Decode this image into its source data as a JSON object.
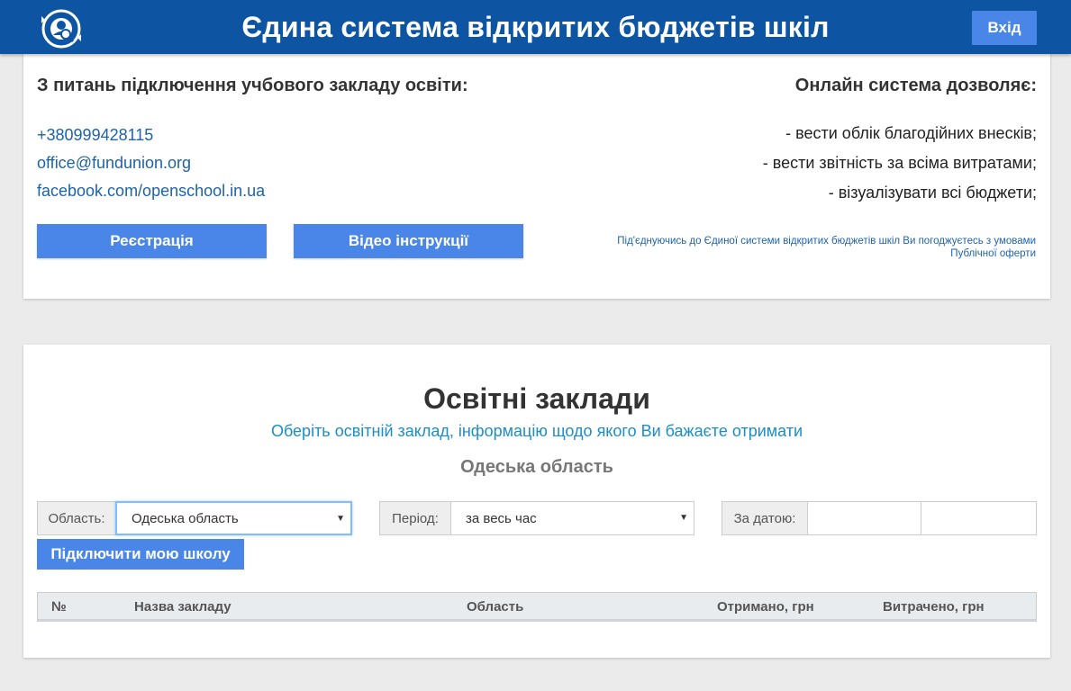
{
  "header": {
    "title": "Єдина система відкритих бюджетів шкіл",
    "login_label": "Вхід",
    "logo_icon": "magnifier-search-logo-icon",
    "background": "#0d55a3"
  },
  "info": {
    "left_title": "З питань підключення учбового закладу освіти:",
    "contacts": [
      "+380999428115",
      "office@fundunion.org",
      "facebook.com/openschool.in.ua"
    ],
    "right_title": "Онлайн система дозволяє:",
    "features": [
      "- вести облік благодійних внесків;",
      "- вести звітність за всіма витратами;",
      "- візуалізувати всі бюджети;"
    ],
    "register_label": "Реєстрація",
    "video_label": "Відео інструкції",
    "terms_line1": "Під'єднуючись до Єдиної системи відкритих бюджетів шкіл Ви погоджуєтесь з умовами",
    "terms_line2": "Публічної оферти"
  },
  "institutions": {
    "title": "Освітні заклади",
    "subtitle": "Оберіть освітній заклад, інформацію щодо якого Ви бажаєте отримати",
    "region_heading": "Одеська область",
    "filters": {
      "region_label": "Область:",
      "region_value": "Одеська область",
      "period_label": "Період:",
      "period_value": "за весь час",
      "date_label": "За датою:",
      "date_from": "",
      "date_to": ""
    },
    "connect_label": "Підключити мою школу",
    "table_headers": [
      "№",
      "Назва закладу",
      "Область",
      "Отримано, грн",
      "Витрачено, грн"
    ]
  },
  "colors": {
    "accent": "#4a86e8",
    "link": "#1e63a8",
    "subtitle": "#1b8ec9"
  }
}
